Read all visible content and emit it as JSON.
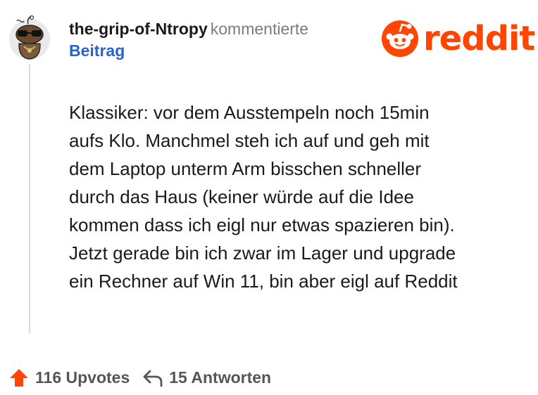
{
  "comment": {
    "username": "the-grip-of-Ntropy",
    "action": "kommentierte",
    "post_link": "Beitrag",
    "text": "Klassiker: vor dem Ausstempeln noch 15min\naufs Klo. Manchmel steh ich auf und geh mit\ndem Laptop unterm Arm bisschen schneller\ndurch das Haus (keiner würde auf die Idee\nkommen dass ich eigl nur etwas spazieren bin).\nJetzt gerade bin ich zwar im Lager und upgrade\nein Rechner auf Win 11, bin aber eigl auf Reddit"
  },
  "brand": {
    "name": "reddit",
    "color": "#ff4500"
  },
  "footer": {
    "upvotes": "116 Upvotes",
    "replies": "15 Antworten"
  },
  "icons": {
    "avatar": "snoo-avatar-with-sunglasses",
    "logo": "reddit-snoo-logo",
    "upvote": "upvote-arrow-icon",
    "reply": "reply-arrow-icon"
  },
  "colors": {
    "link": "#2a63c7",
    "muted": "#7c7c7c",
    "upvote": "#ff4500",
    "thread_line": "#dcdcdc"
  }
}
